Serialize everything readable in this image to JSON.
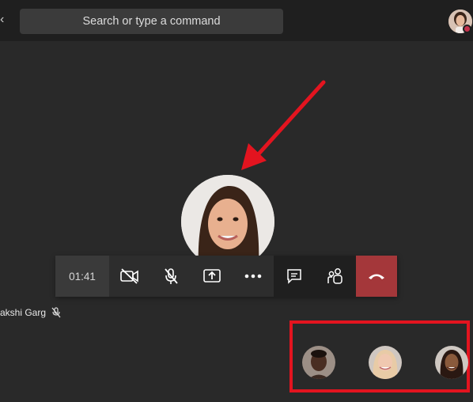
{
  "header": {
    "search_placeholder": "Search or type a command",
    "back_icon": "back-icon",
    "profile_status_color": "#c4314b"
  },
  "call": {
    "duration": "01:41",
    "participant_name": "akshi Garg",
    "controls": [
      {
        "name": "camera-off-icon"
      },
      {
        "name": "mic-muted-icon"
      },
      {
        "name": "share-screen-icon"
      },
      {
        "name": "more-options-icon"
      },
      {
        "name": "chat-icon"
      },
      {
        "name": "participants-icon"
      },
      {
        "name": "hang-up-icon",
        "color": "#a4373a"
      }
    ]
  },
  "annotations": {
    "highlight_color": "#e3141f"
  }
}
